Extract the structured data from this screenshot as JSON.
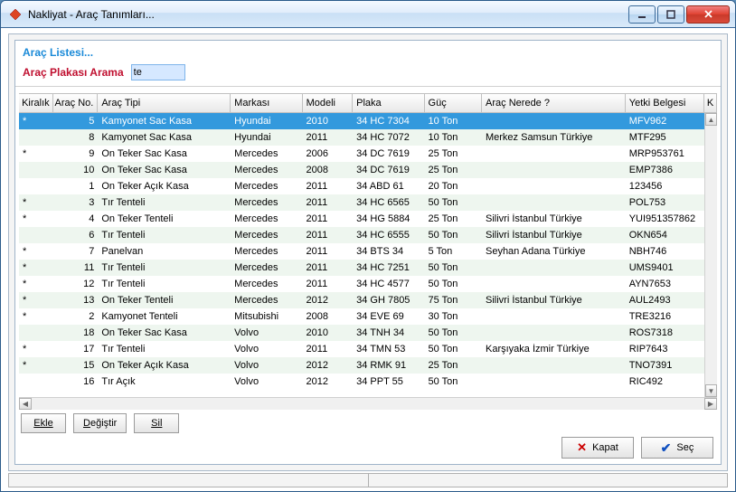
{
  "window": {
    "title": "Nakliyat - Araç Tanımları..."
  },
  "header": {
    "list_title": "Araç Listesi..."
  },
  "search": {
    "label": "Araç Plakası Arama",
    "value": "te"
  },
  "columns": {
    "kiralik": "Kiralık",
    "aracno": "Araç No.",
    "tipi": "Araç Tipi",
    "marka": "Markası",
    "model": "Modeli",
    "plaka": "Plaka",
    "guc": "Güç",
    "nerede": "Araç Nerede ?",
    "yetki": "Yetki Belgesi",
    "k": "K"
  },
  "rows": [
    {
      "kiralik": "*",
      "aracno": "5",
      "tipi": "Kamyonet Sac Kasa",
      "marka": "Hyundai",
      "model": "2010",
      "plaka": "34 HC 7304",
      "guc": "10 Ton",
      "nerede": "",
      "yetki": "MFV962",
      "selected": true
    },
    {
      "kiralik": "",
      "aracno": "8",
      "tipi": "Kamyonet Sac Kasa",
      "marka": "Hyundai",
      "model": "2011",
      "plaka": "34 HC 7072",
      "guc": "10 Ton",
      "nerede": "Merkez Samsun Türkiye",
      "yetki": "MTF295"
    },
    {
      "kiralik": "*",
      "aracno": "9",
      "tipi": "On Teker Sac Kasa",
      "marka": "Mercedes",
      "model": "2006",
      "plaka": "34 DC 7619",
      "guc": "25 Ton",
      "nerede": "",
      "yetki": "MRP953761"
    },
    {
      "kiralik": "",
      "aracno": "10",
      "tipi": "On Teker Sac Kasa",
      "marka": "Mercedes",
      "model": "2008",
      "plaka": "34 DC 7619",
      "guc": "25 Ton",
      "nerede": "",
      "yetki": "EMP7386"
    },
    {
      "kiralik": "",
      "aracno": "1",
      "tipi": "On Teker Açık Kasa",
      "marka": "Mercedes",
      "model": "2011",
      "plaka": "34 ABD 61",
      "guc": "20 Ton",
      "nerede": "",
      "yetki": "123456"
    },
    {
      "kiralik": "*",
      "aracno": "3",
      "tipi": "Tır Tenteli",
      "marka": "Mercedes",
      "model": "2011",
      "plaka": "34 HC 6565",
      "guc": "50 Ton",
      "nerede": "",
      "yetki": "POL753"
    },
    {
      "kiralik": "*",
      "aracno": "4",
      "tipi": "On Teker Tenteli",
      "marka": "Mercedes",
      "model": "2011",
      "plaka": "34 HG 5884",
      "guc": "25 Ton",
      "nerede": "Silivri İstanbul Türkiye",
      "yetki": "YUI951357862"
    },
    {
      "kiralik": "",
      "aracno": "6",
      "tipi": "Tır Tenteli",
      "marka": "Mercedes",
      "model": "2011",
      "plaka": "34 HC 6555",
      "guc": "50 Ton",
      "nerede": "Silivri İstanbul Türkiye",
      "yetki": "OKN654"
    },
    {
      "kiralik": "*",
      "aracno": "7",
      "tipi": "Panelvan",
      "marka": "Mercedes",
      "model": "2011",
      "plaka": "34 BTS 34",
      "guc": "5 Ton",
      "nerede": "Seyhan Adana Türkiye",
      "yetki": "NBH746"
    },
    {
      "kiralik": "*",
      "aracno": "11",
      "tipi": "Tır Tenteli",
      "marka": "Mercedes",
      "model": "2011",
      "plaka": "34 HC 7251",
      "guc": "50 Ton",
      "nerede": "",
      "yetki": "UMS9401"
    },
    {
      "kiralik": "*",
      "aracno": "12",
      "tipi": "Tır Tenteli",
      "marka": "Mercedes",
      "model": "2011",
      "plaka": "34 HC 4577",
      "guc": "50 Ton",
      "nerede": "",
      "yetki": "AYN7653"
    },
    {
      "kiralik": "*",
      "aracno": "13",
      "tipi": "On Teker Tenteli",
      "marka": "Mercedes",
      "model": "2012",
      "plaka": "34 GH 7805",
      "guc": "75 Ton",
      "nerede": "Silivri İstanbul Türkiye",
      "yetki": "AUL2493"
    },
    {
      "kiralik": "*",
      "aracno": "2",
      "tipi": "Kamyonet Tenteli",
      "marka": "Mitsubishi",
      "model": "2008",
      "plaka": "34 EVE 69",
      "guc": "30 Ton",
      "nerede": "",
      "yetki": "TRE3216"
    },
    {
      "kiralik": "",
      "aracno": "18",
      "tipi": "On Teker Sac Kasa",
      "marka": "Volvo",
      "model": "2010",
      "plaka": "34 TNH 34",
      "guc": "50 Ton",
      "nerede": "",
      "yetki": "ROS7318"
    },
    {
      "kiralik": "*",
      "aracno": "17",
      "tipi": "Tır Tenteli",
      "marka": "Volvo",
      "model": "2011",
      "plaka": "34 TMN 53",
      "guc": "50 Ton",
      "nerede": "Karşıyaka İzmir Türkiye",
      "yetki": "RIP7643"
    },
    {
      "kiralik": "*",
      "aracno": "15",
      "tipi": "On Teker Açık Kasa",
      "marka": "Volvo",
      "model": "2012",
      "plaka": "34 RMK 91",
      "guc": "25 Ton",
      "nerede": "",
      "yetki": "TNO7391"
    },
    {
      "kiralik": "",
      "aracno": "16",
      "tipi": "Tır Açık",
      "marka": "Volvo",
      "model": "2012",
      "plaka": "34 PPT 55",
      "guc": "50 Ton",
      "nerede": "",
      "yetki": "RIC492"
    }
  ],
  "buttons": {
    "ekle": "Ekle",
    "degistir": "Değiştir",
    "sil": "Sil",
    "kapat": "Kapat",
    "sec": "Seç"
  }
}
